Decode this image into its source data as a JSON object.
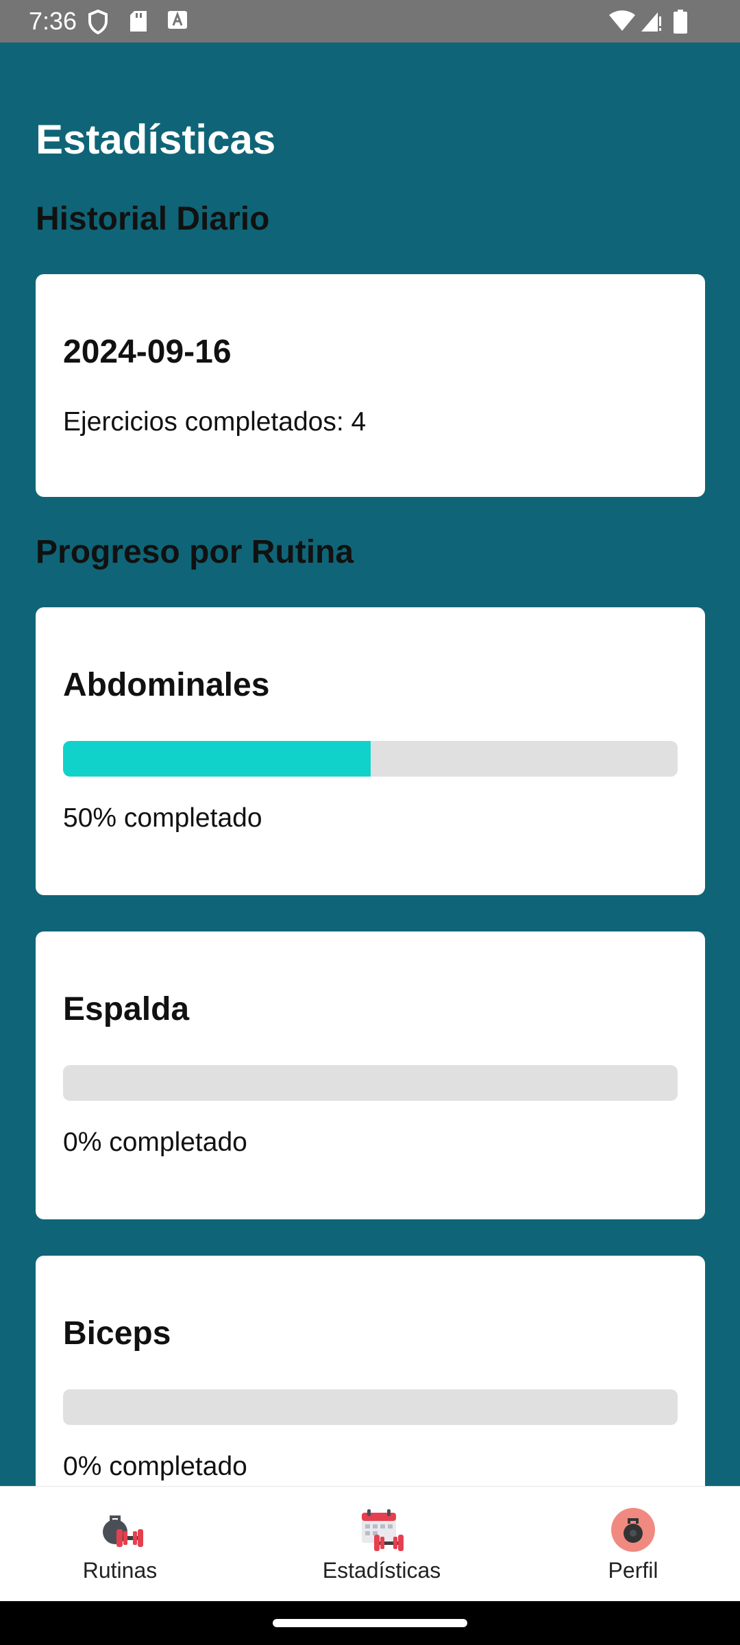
{
  "status_bar": {
    "time": "7:36",
    "icons_left": [
      "shield-icon",
      "sd-card-icon",
      "text-a-icon"
    ],
    "icons_right": [
      "wifi-icon",
      "signal-icon",
      "battery-icon"
    ]
  },
  "page": {
    "title": "Estadísticas"
  },
  "daily_history": {
    "heading": "Historial Diario",
    "entries": [
      {
        "date": "2024-09-16",
        "summary": "Ejercicios completados: 4"
      }
    ]
  },
  "routine_progress": {
    "heading": "Progreso por Rutina",
    "items": [
      {
        "name": "Abdominales",
        "progress": 0.5,
        "label": "50% completado"
      },
      {
        "name": "Espalda",
        "progress": 0,
        "label": "0% completado"
      },
      {
        "name": "Biceps",
        "progress": 0,
        "label": "0% completado"
      }
    ]
  },
  "colors": {
    "background": "#0f6577",
    "card": "#ffffff",
    "progress_fill": "#10d2cb",
    "progress_track": "#e0e0e0"
  },
  "bottom_nav": {
    "items": [
      {
        "label": "Rutinas",
        "icon": "kettlebell-dumbbell-icon"
      },
      {
        "label": "Estadísticas",
        "icon": "calendar-dumbbell-icon"
      },
      {
        "label": "Perfil",
        "icon": "profile-kettlebell-icon"
      }
    ]
  }
}
